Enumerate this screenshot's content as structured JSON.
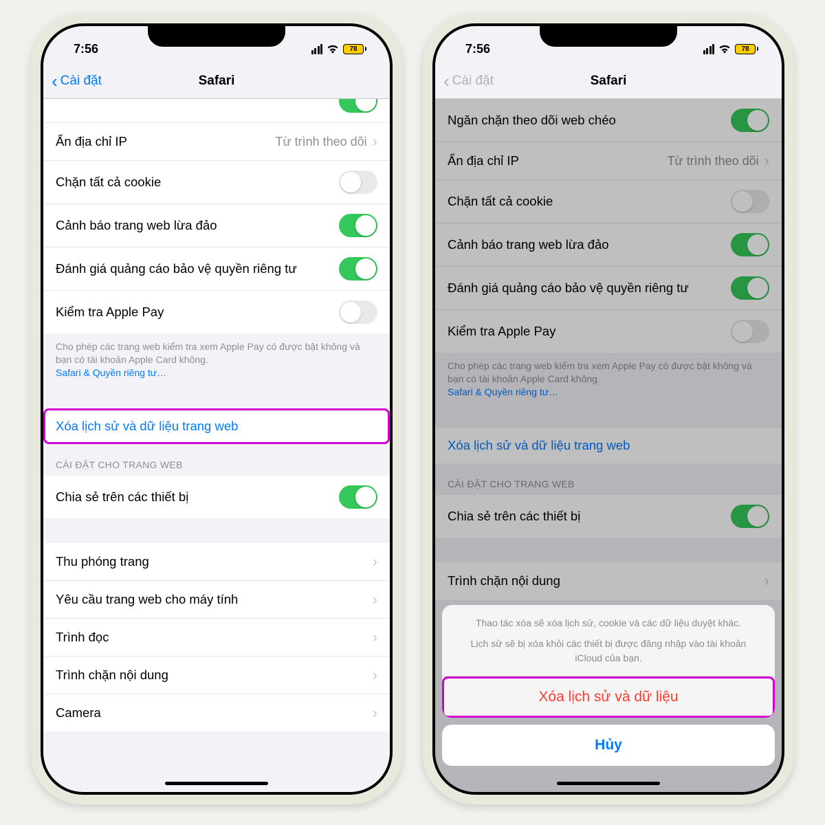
{
  "status": {
    "time": "7:56",
    "battery": "78"
  },
  "nav": {
    "back": "Cài đặt",
    "title": "Safari"
  },
  "rows": {
    "prevent_tracking": "Ngăn chặn theo dõi web chéo",
    "hide_ip": "Ẩn địa chỉ IP",
    "hide_ip_detail": "Từ trình theo dõi",
    "block_cookies": "Chặn tất cả cookie",
    "fraud_warning": "Cảnh báo trang web lừa đảo",
    "ad_privacy": "Đánh giá quảng cáo bảo vệ quyền riêng tư",
    "apple_pay": "Kiểm tra Apple Pay",
    "clear_history": "Xóa lịch sử và dữ liệu trang web",
    "share_devices": "Chia sẻ trên các thiết bị",
    "page_zoom": "Thu phóng trang",
    "desktop_site": "Yêu cầu trang web cho máy tính",
    "reader": "Trình đọc",
    "content_blocker": "Trình chặn nội dung",
    "camera": "Camera"
  },
  "footer": {
    "apple_pay_note": "Cho phép các trang web kiểm tra xem Apple Pay có được bật không và bạn có tài khoản Apple Card không.",
    "privacy_link": "Safari & Quyền riêng tư…"
  },
  "section": {
    "web_settings": "CÀI ĐẶT CHO TRANG WEB"
  },
  "sheet": {
    "msg1": "Thao tác xóa sẽ xóa lịch sử, cookie và các dữ liệu duyệt khác.",
    "msg2": "Lịch sử sẽ bị xóa khỏi các thiết bị được đăng nhập vào tài khoản iCloud của bạn.",
    "action": "Xóa lịch sử và dữ liệu",
    "cancel": "Hủy"
  }
}
